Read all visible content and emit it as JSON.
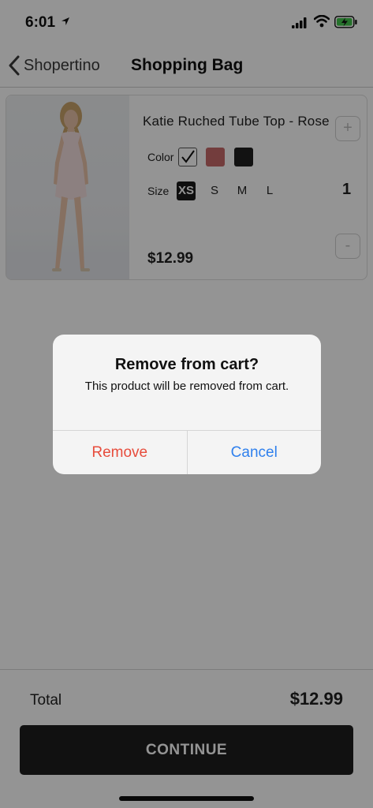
{
  "status_bar": {
    "time": "6:01"
  },
  "nav": {
    "back_label": "Shopertino",
    "title": "Shopping Bag"
  },
  "product": {
    "name": "Katie Ruched Tube Top - Rose",
    "color_label": "Color",
    "colors": [
      "#ffffff",
      "#c66a6a",
      "#1f1f1f"
    ],
    "size_label": "Size",
    "sizes": [
      "XS",
      "S",
      "M",
      "L"
    ],
    "selected_size": "XS",
    "quantity": "1",
    "price": "$12.99",
    "plus": "+",
    "minus": "-"
  },
  "footer": {
    "total_label": "Total",
    "total_value": "$12.99",
    "continue_label": "CONTINUE"
  },
  "alert": {
    "title": "Remove from cart?",
    "message": "This product will be removed from cart.",
    "remove_label": "Remove",
    "cancel_label": "Cancel"
  },
  "colors": {
    "remove": "#e74c3c",
    "cancel": "#2f80ed",
    "dark": "#1e1e1e"
  }
}
